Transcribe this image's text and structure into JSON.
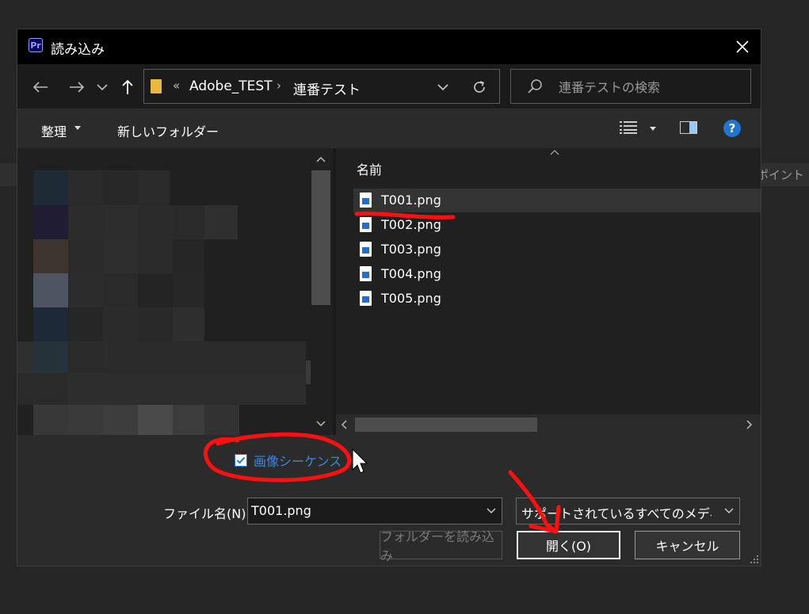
{
  "background": {
    "side_label": "ポイント"
  },
  "dialog": {
    "app_badge": "Pr",
    "title": "読み込み",
    "breadcrumb": {
      "prefix": "«",
      "folder1": "Adobe_TEST",
      "separator": "›",
      "folder2": "連番テスト"
    },
    "search": {
      "placeholder": "連番テストの検索"
    },
    "toolbar": {
      "organize_label": "整理",
      "new_folder_label": "新しいフォルダー",
      "help_label": "?"
    },
    "file_list": {
      "column_name": "名前",
      "files": [
        {
          "name": "T001.png",
          "selected": true
        },
        {
          "name": "T002.png",
          "selected": false
        },
        {
          "name": "T003.png",
          "selected": false
        },
        {
          "name": "T004.png",
          "selected": false
        },
        {
          "name": "T005.png",
          "selected": false
        }
      ]
    },
    "image_sequence": {
      "label": "画像シーケンス",
      "checked": true
    },
    "filename": {
      "label": "ファイル名(N):",
      "value": "T001.png"
    },
    "filetype": {
      "value": "サポートされているすべてのメディア (*"
    },
    "buttons": {
      "import_folder": "フォルダーを読み込み",
      "open": "開く(O)",
      "cancel": "キャンセル"
    }
  },
  "colors": {
    "accent_blue": "#1f76d0",
    "annotation_red": "#ff1010",
    "folder_yellow": "#e9b93f"
  }
}
